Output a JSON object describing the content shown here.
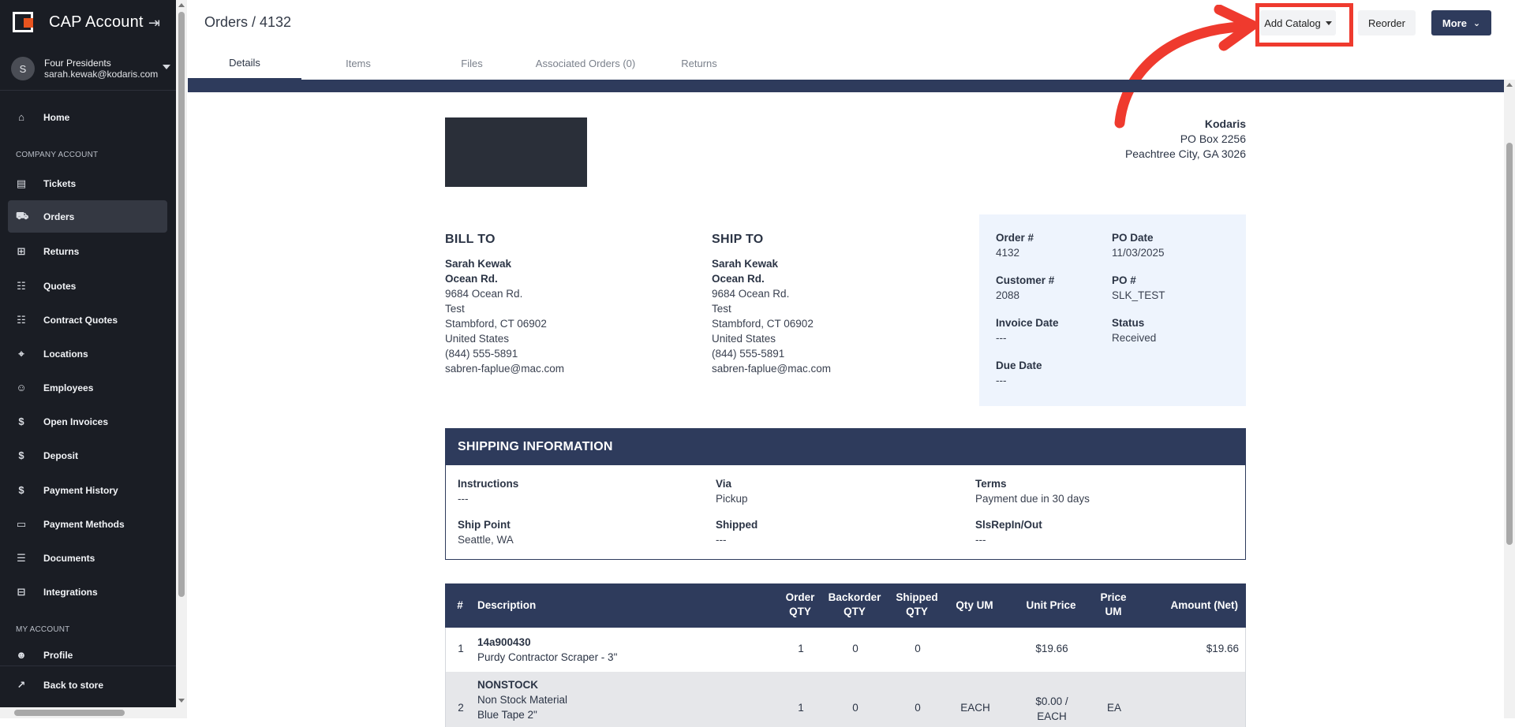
{
  "sidebar": {
    "app_title": "CAP Account",
    "user": {
      "initial": "S",
      "company": "Four Presidents",
      "email": "sarah.kewak@kodaris.com"
    },
    "items": [
      {
        "label": "Home"
      },
      {
        "label": "Tickets"
      },
      {
        "label": "Orders"
      },
      {
        "label": "Returns"
      },
      {
        "label": "Quotes"
      },
      {
        "label": "Contract Quotes"
      },
      {
        "label": "Locations"
      },
      {
        "label": "Employees"
      },
      {
        "label": "Open Invoices"
      },
      {
        "label": "Deposit"
      },
      {
        "label": "Payment History"
      },
      {
        "label": "Payment Methods"
      },
      {
        "label": "Documents"
      },
      {
        "label": "Integrations"
      },
      {
        "label": "Profile"
      },
      {
        "label": "Back to store"
      }
    ],
    "sections": {
      "company": "COMPANY ACCOUNT",
      "my_account": "MY ACCOUNT"
    }
  },
  "header": {
    "title": "Orders / 4132",
    "add_catalog": "Add Catalog",
    "reorder": "Reorder",
    "more": "More",
    "highlight_color": "#ef3a2e"
  },
  "tabs": [
    {
      "label": "Details"
    },
    {
      "label": "Items"
    },
    {
      "label": "Files"
    },
    {
      "label": "Associated Orders (0)"
    },
    {
      "label": "Returns"
    }
  ],
  "company": {
    "name": "Kodaris",
    "line1": "PO Box 2256",
    "line2": "Peachtree City, GA 3026"
  },
  "bill_to": {
    "heading": "BILL TO",
    "name": "Sarah Kewak",
    "street_name": "Ocean Rd.",
    "address": "9684 Ocean Rd.",
    "line2": "Test",
    "city": "Stambford, CT 06902",
    "country": "United States",
    "phone": "(844) 555-5891",
    "email": "sabren-faplue@mac.com"
  },
  "ship_to": {
    "heading": "SHIP TO",
    "name": "Sarah Kewak",
    "street_name": "Ocean Rd.",
    "address": "9684 Ocean Rd.",
    "line2": "Test",
    "city": "Stambford, CT 06902",
    "country": "United States",
    "phone": "(844) 555-5891",
    "email": "sabren-faplue@mac.com"
  },
  "order_info": {
    "order_no_label": "Order #",
    "order_no": "4132",
    "po_date_label": "PO Date",
    "po_date": "11/03/2025",
    "customer_label": "Customer #",
    "customer": "2088",
    "po_label": "PO #",
    "po": "SLK_TEST",
    "invoice_date_label": "Invoice Date",
    "invoice_date": "---",
    "status_label": "Status",
    "status": "Received",
    "due_date_label": "Due Date",
    "due_date": "---"
  },
  "shipping": {
    "heading": "SHIPPING INFORMATION",
    "instructions_label": "Instructions",
    "instructions": "---",
    "via_label": "Via",
    "via": "Pickup",
    "terms_label": "Terms",
    "terms": "Payment due in 30 days",
    "ship_point_label": "Ship Point",
    "ship_point": "Seattle, WA",
    "shipped_label": "Shipped",
    "shipped": "---",
    "slsrep_label": "SlsRepIn/Out",
    "slsrep": "---"
  },
  "items_table": {
    "headers": {
      "num": "#",
      "description": "Description",
      "order_qty_1": "Order",
      "order_qty_2": "QTY",
      "backorder_1": "Backorder",
      "backorder_2": "QTY",
      "shipped_1": "Shipped",
      "shipped_2": "QTY",
      "qty_um": "Qty UM",
      "unit_price": "Unit Price",
      "price_um_1": "Price",
      "price_um_2": "UM",
      "amount": "Amount (Net)"
    },
    "rows": [
      {
        "num": "1",
        "sku": "14a900430",
        "desc": "Purdy Contractor Scraper - 3\"",
        "order_qty": "1",
        "backorder": "0",
        "shipped": "0",
        "qty_um": "",
        "unit_price": "$19.66",
        "price_um": "",
        "amount": "$19.66"
      },
      {
        "num": "2",
        "sku": "NONSTOCK",
        "desc": "Non Stock Material",
        "desc2": "Blue Tape 2\"",
        "order_qty": "1",
        "backorder": "0",
        "shipped": "0",
        "qty_um": "EACH",
        "unit_price": "$0.00 /",
        "unit_price2": "EACH",
        "price_um": "EA",
        "amount": ""
      }
    ]
  }
}
